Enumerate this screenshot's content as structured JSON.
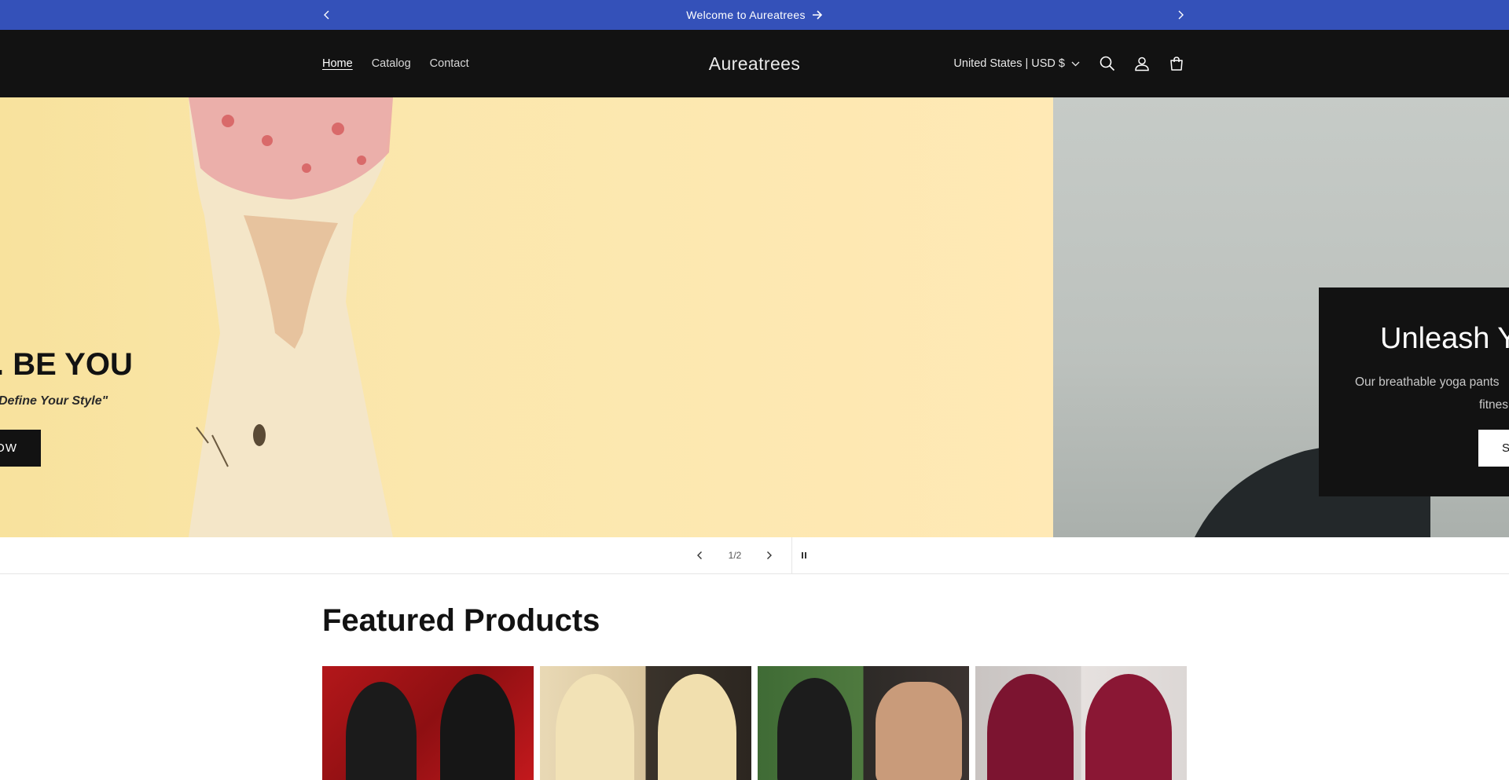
{
  "announcement": {
    "text": "Welcome to Aureatrees"
  },
  "header": {
    "logo": "Aureatrees",
    "nav": [
      {
        "label": "Home",
        "active": true
      },
      {
        "label": "Catalog",
        "active": false
      },
      {
        "label": "Contact",
        "active": false
      }
    ],
    "country_selector": "United States | USD $"
  },
  "hero": {
    "slide1": {
      "heading": ". BE YOU",
      "subheading": "Define Your Style\"",
      "button": "OW"
    },
    "slide2": {
      "heading": "Unleash Y",
      "text_line1": "Our breathable yoga pants",
      "text_line2": "fitnes",
      "button": "S"
    },
    "counter": "1/2"
  },
  "featured": {
    "title": "Featured Products"
  },
  "colors": {
    "announcement_bg": "#3451b9",
    "header_bg": "#121212",
    "hero_yellow": "#fbe7ad",
    "hero_grey": "#c1c6c2"
  }
}
